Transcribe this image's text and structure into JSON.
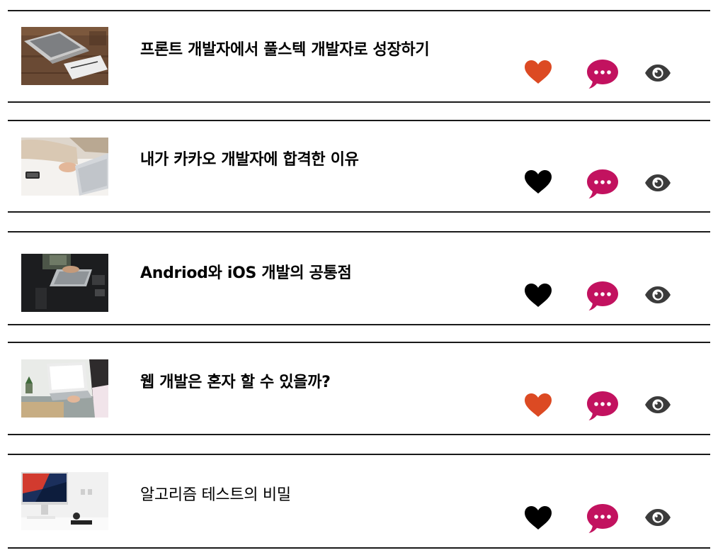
{
  "colors": {
    "liked_heart": "#dc4a23",
    "heart": "#000000",
    "comment": "#c2125f",
    "eye": "#3b3b3b",
    "rule": "#1a1a1a"
  },
  "posts": [
    {
      "title": "프론트 개발자에서 풀스텍 개발자로 성장하기",
      "title_weight": "bold",
      "liked": true,
      "thumbnail": "laptop-on-wooden-desk",
      "icons": [
        "heart-icon",
        "comment-icon",
        "eye-icon"
      ]
    },
    {
      "title": "내가 카카오 개발자에 합격한 이유",
      "title_weight": "bold",
      "liked": false,
      "thumbnail": "person-typing-on-laptop",
      "icons": [
        "heart-icon",
        "comment-icon",
        "eye-icon"
      ]
    },
    {
      "title": "Andriod와 iOS 개발의 공통점",
      "title_weight": "bold",
      "liked": false,
      "thumbnail": "laptop-on-dark-desk",
      "icons": [
        "heart-icon",
        "comment-icon",
        "eye-icon"
      ]
    },
    {
      "title": "웹 개발은 혼자 할 수 있을까?",
      "title_weight": "bold",
      "liked": true,
      "thumbnail": "woman-using-laptop",
      "icons": [
        "heart-icon",
        "comment-icon",
        "eye-icon"
      ]
    },
    {
      "title": "알고리즘 테스트의 비밀",
      "title_weight": "normal",
      "liked": false,
      "thumbnail": "imac-workspace",
      "icons": [
        "heart-icon",
        "comment-icon",
        "eye-icon"
      ]
    }
  ]
}
